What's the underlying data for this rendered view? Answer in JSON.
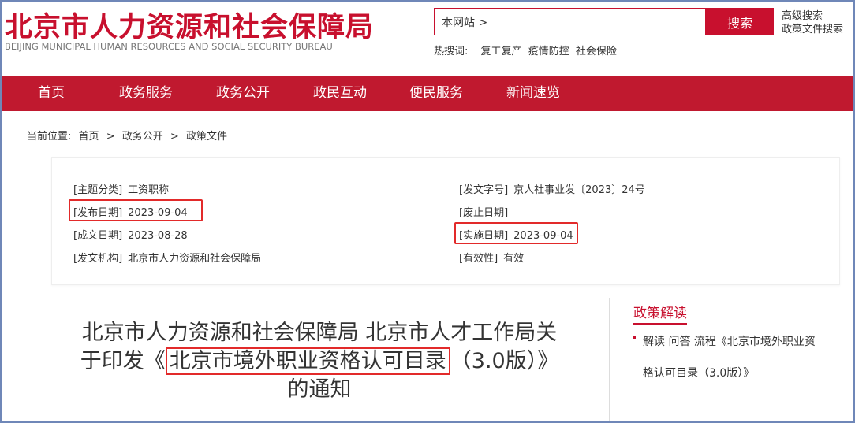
{
  "header": {
    "logo_cn": "北京市人力资源和社会保障局",
    "logo_en": "BEIJING MUNICIPAL HUMAN RESOURCES AND SOCIAL SECURITY BUREAU",
    "search_value": "本网站 >",
    "search_button": "搜索",
    "advanced_search": "高级搜索",
    "policy_file_search": "政策文件搜索",
    "hotwords_label": "热搜词:",
    "hotwords": [
      "复工复产",
      "疫情防控",
      "社会保险"
    ]
  },
  "nav": {
    "items": [
      "首页",
      "政务服务",
      "政务公开",
      "政民互动",
      "便民服务",
      "新闻速览"
    ]
  },
  "breadcrumb": {
    "label": "当前位置:",
    "path": [
      "首页",
      "政务公开",
      "政策文件"
    ],
    "separator": ">"
  },
  "meta": {
    "left": [
      {
        "key": "[主题分类]",
        "value": "工资职称"
      },
      {
        "key": "[发布日期]",
        "value": "2023-09-04"
      },
      {
        "key": "[成文日期]",
        "value": "2023-08-28"
      },
      {
        "key": "[发文机构]",
        "value": "北京市人力资源和社会保障局"
      }
    ],
    "right": [
      {
        "key": "[发文字号]",
        "value": "京人社事业发〔2023〕24号"
      },
      {
        "key": "[废止日期]",
        "value": ""
      },
      {
        "key": "[实施日期]",
        "value": "2023-09-04"
      },
      {
        "key": "[有效性]",
        "value": "有效"
      }
    ]
  },
  "title": {
    "line1": "北京市人力资源和社会保障局 北京市人才工作局关",
    "line2_prefix": "于印发《",
    "line2_highlight": "北京市境外职业资格认可目录",
    "line2_suffix": "（3.0版）》",
    "line3": "的通知"
  },
  "sidebar": {
    "heading": "政策解读",
    "related_line1": "解读 问答 流程《北京市境外职业资",
    "related_line2": "格认可目录（3.0版）》"
  },
  "colors": {
    "brand_red": "#c8102e",
    "nav_red": "#c0192f",
    "highlight_red": "#e22a2a",
    "frame_blue": "#6f87b8"
  }
}
